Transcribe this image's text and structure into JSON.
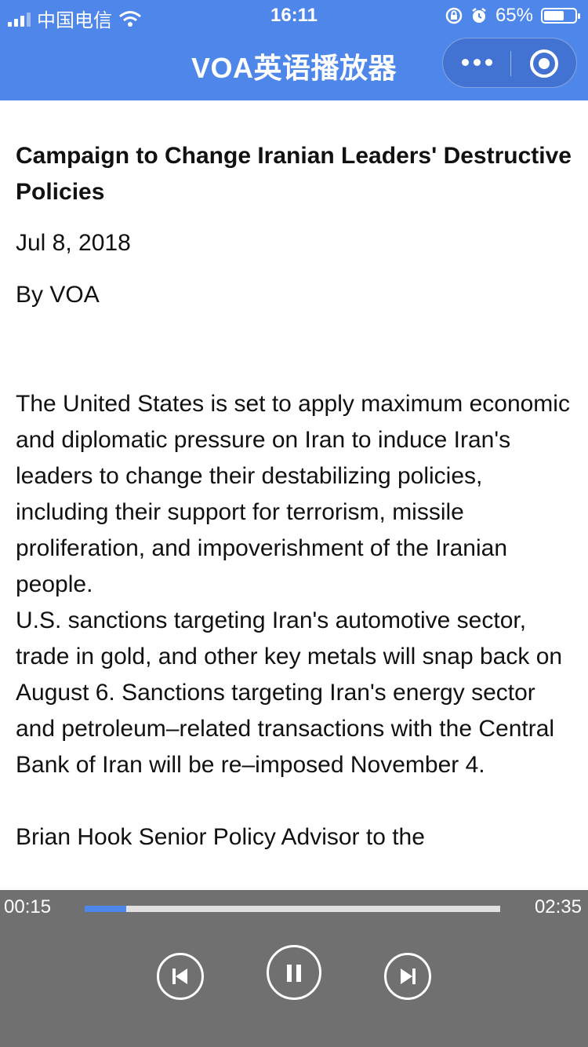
{
  "status_bar": {
    "carrier": "中国电信",
    "time": "16:11",
    "battery_percent": "65%",
    "battery_level": 0.65
  },
  "nav": {
    "title": "VOA英语播放器"
  },
  "article": {
    "title": "Campaign to Change Iranian Leaders' Destructive Policies",
    "date": "Jul 8, 2018",
    "byline": "By VOA",
    "paragraphs": [
      "The United States is set to apply maximum economic and diplomatic pressure on Iran to induce Iran's leaders to change their destabilizing policies, including their support for terrorism, missile proliferation, and impoverishment of the Iranian people.",
      "U.S. sanctions targeting Iran's automotive sector, trade in gold, and other key metals will snap back on August 6. Sanctions targeting Iran's energy sector and petroleum–related transactions with the Central Bank of Iran will be re–imposed November 4.",
      "Brian Hook Senior Policy Advisor to the"
    ]
  },
  "player": {
    "current_time": "00:15",
    "total_time": "02:35",
    "progress": 0.1,
    "colors": {
      "accent": "#4f86ea",
      "background": "#707070"
    }
  },
  "icons": {
    "signal": "signal-icon",
    "wifi": "wifi-icon",
    "lock": "orientation-lock-icon",
    "alarm": "alarm-icon",
    "battery": "battery-icon",
    "more": "more-dots-icon",
    "close": "target-close-icon",
    "prev": "previous-track-icon",
    "pause": "pause-icon",
    "next": "next-track-icon"
  }
}
